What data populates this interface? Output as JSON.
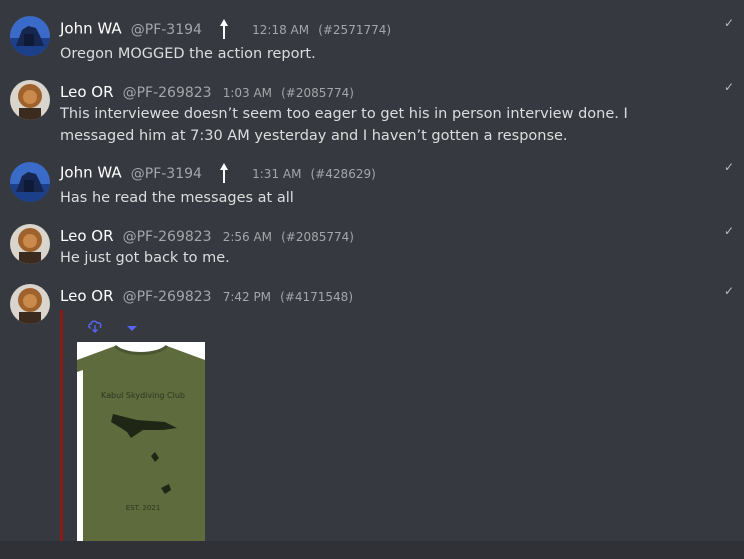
{
  "messages": [
    {
      "name": "John WA",
      "handle": "@PF-3194",
      "time": "12:18 AM",
      "ref": "(#2571774)",
      "text": "Oregon MOGGED the action report.",
      "pinned": true,
      "check": "✓"
    },
    {
      "name": "Leo OR",
      "handle": "@PF-269823",
      "time": "1:03 AM",
      "ref": "(#2085774)",
      "text": "This interviewee doesn’t seem too eager to get his in person interview done. I messaged him at 7:30 AM yesterday and I haven’t gotten a response.",
      "pinned": false,
      "check": "✓"
    },
    {
      "name": "John WA",
      "handle": "@PF-3194",
      "time": "1:31 AM",
      "ref": "(#428629)",
      "text": "Has he read the messages at all",
      "pinned": true,
      "check": "✓"
    },
    {
      "name": "Leo OR",
      "handle": "@PF-269823",
      "time": "2:56 AM",
      "ref": "(#2085774)",
      "text": "He just got back to me.",
      "pinned": false,
      "check": "✓"
    },
    {
      "name": "Leo OR",
      "handle": "@PF-269823",
      "time": "7:42 PM",
      "ref": "(#4171548)",
      "text": "",
      "pinned": false,
      "check": "✓"
    }
  ],
  "embed": {
    "icons": [
      "download-cloud-icon",
      "chevron-down-icon"
    ],
    "image_text": {
      "title": "Kabul Skydiving Club",
      "footer": "EST. 2021"
    }
  },
  "colors": {
    "background": "#36393f",
    "embed_border": "#8b1a1a",
    "icon_blue": "#5865f2"
  }
}
